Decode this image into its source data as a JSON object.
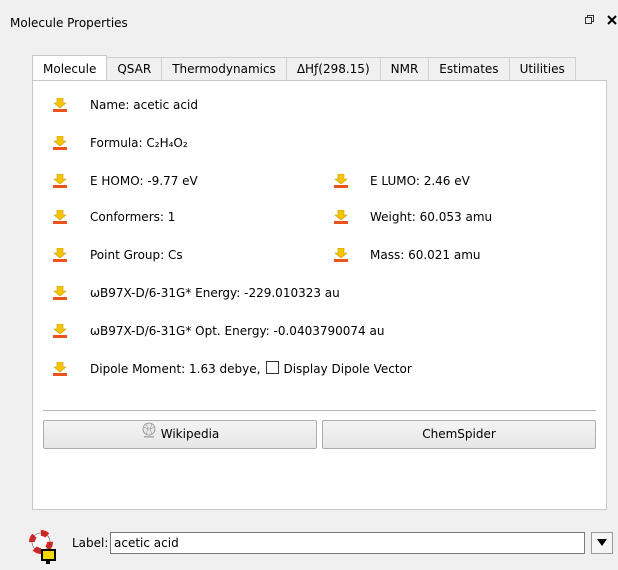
{
  "window": {
    "title": "Molecule Properties",
    "float_glyph": "🗗",
    "close_glyph": "✕"
  },
  "tabs": [
    {
      "label": "Molecule",
      "active": true
    },
    {
      "label": "QSAR"
    },
    {
      "label": "Thermodynamics"
    },
    {
      "label": "ΔHƒ(298.15)"
    },
    {
      "label": "NMR"
    },
    {
      "label": "Estimates"
    },
    {
      "label": "Utilities"
    }
  ],
  "properties": {
    "name": "Name: acetic acid",
    "formula": "Formula: C₂H₄O₂",
    "homo": "E HOMO: -9.77 eV",
    "lumo": "E LUMO: 2.46 eV",
    "conformers": "Conformers: 1",
    "weight": "Weight: 60.053 amu",
    "point_group": "Point Group: Cs",
    "mass": "Mass: 60.021 amu",
    "energy": "ωB97X-D/6-31G* Energy: -229.010323 au",
    "opt_energy": "ωB97X-D/6-31G* Opt. Energy: -0.0403790074 au",
    "dipole": "Dipole Moment: 1.63 debye,",
    "dipole_checkbox_label": "Display Dipole Vector"
  },
  "buttons": {
    "wikipedia": "Wikipedia",
    "chemspider": "ChemSpider"
  },
  "label_bar": {
    "label": "Label:",
    "value": "acetic acid"
  },
  "colors": {
    "icon_yellow": "#f5c400",
    "icon_orange": "#e8541c"
  }
}
